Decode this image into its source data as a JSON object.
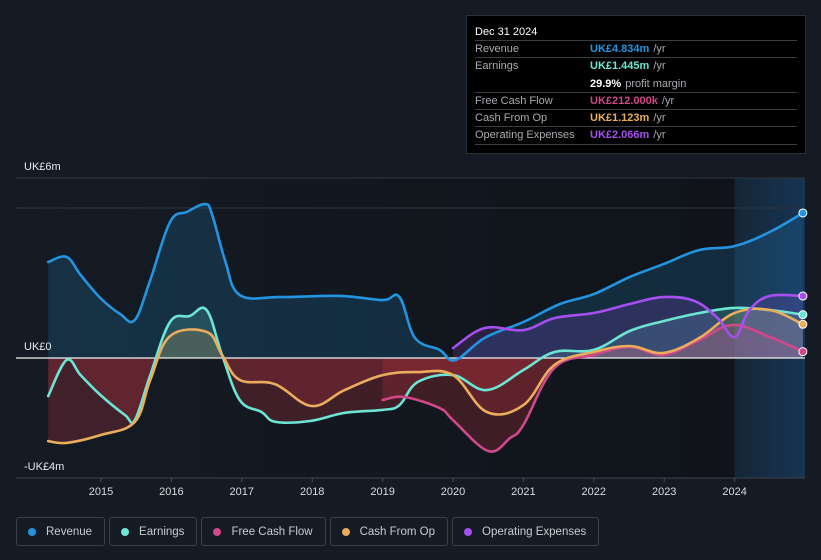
{
  "tooltip": {
    "date": "Dec 31 2024",
    "rows": [
      {
        "label": "Revenue",
        "value": "UK£4.834m",
        "unit": "/yr",
        "color": "#2394df"
      },
      {
        "label": "Earnings",
        "value": "UK£1.445m",
        "unit": "/yr",
        "color": "#6ce5d4"
      },
      {
        "label": "",
        "value": "29.9%",
        "unit": "profit margin",
        "color": "#ffffff"
      },
      {
        "label": "Free Cash Flow",
        "value": "UK£212.000k",
        "unit": "/yr",
        "color": "#d0478a"
      },
      {
        "label": "Cash From Op",
        "value": "UK£1.123m",
        "unit": "/yr",
        "color": "#e9ad5c"
      },
      {
        "label": "Operating Expenses",
        "value": "UK£2.066m",
        "unit": "/yr",
        "color": "#a54ff0"
      }
    ]
  },
  "legend": [
    {
      "label": "Revenue",
      "color": "#2394df"
    },
    {
      "label": "Earnings",
      "color": "#6ce5d4"
    },
    {
      "label": "Free Cash Flow",
      "color": "#d0478a"
    },
    {
      "label": "Cash From Op",
      "color": "#e9ad5c"
    },
    {
      "label": "Operating Expenses",
      "color": "#a54ff0"
    }
  ],
  "chart_data": {
    "type": "area",
    "title": "",
    "xlabel": "",
    "ylabel": "",
    "currency_unit": "UK£m",
    "y_tick_labels": [
      {
        "value": 6,
        "label": "UK£6m"
      },
      {
        "value": 0,
        "label": "UK£0"
      },
      {
        "value": -4,
        "label": "-UK£4m"
      }
    ],
    "ylim": [
      -4,
      6
    ],
    "xlim": [
      2014.25,
      2024.98
    ],
    "x_ticks": [
      "2015",
      "2016",
      "2017",
      "2018",
      "2019",
      "2020",
      "2021",
      "2022",
      "2023",
      "2024"
    ],
    "highlight_from": 2024.0,
    "grid": true,
    "legend_position": "bottom",
    "series": [
      {
        "name": "Revenue",
        "color": "#2394df",
        "points": [
          [
            2014.25,
            3.2
          ],
          [
            2014.51,
            3.37
          ],
          [
            2014.71,
            2.77
          ],
          [
            2014.99,
            2.0
          ],
          [
            2015.27,
            1.47
          ],
          [
            2015.48,
            1.27
          ],
          [
            2015.7,
            2.6
          ],
          [
            2015.98,
            4.53
          ],
          [
            2016.22,
            4.87
          ],
          [
            2016.48,
            5.13
          ],
          [
            2016.58,
            4.77
          ],
          [
            2016.76,
            3.27
          ],
          [
            2016.97,
            2.1
          ],
          [
            2017.54,
            2.03
          ],
          [
            2018.39,
            2.07
          ],
          [
            2019.0,
            1.93
          ],
          [
            2019.24,
            2.03
          ],
          [
            2019.46,
            0.67
          ],
          [
            2019.81,
            0.27
          ],
          [
            2020.03,
            -0.07
          ],
          [
            2020.45,
            0.67
          ],
          [
            2021.0,
            1.2
          ],
          [
            2021.52,
            1.8
          ],
          [
            2022.0,
            2.13
          ],
          [
            2022.51,
            2.7
          ],
          [
            2022.99,
            3.13
          ],
          [
            2023.5,
            3.6
          ],
          [
            2024.0,
            3.73
          ],
          [
            2024.5,
            4.2
          ],
          [
            2024.97,
            4.834
          ]
        ]
      },
      {
        "name": "Earnings",
        "color": "#6ce5d4",
        "points": [
          [
            2014.25,
            -1.27
          ],
          [
            2014.51,
            -0.07
          ],
          [
            2014.71,
            -0.57
          ],
          [
            2014.99,
            -1.23
          ],
          [
            2015.34,
            -1.9
          ],
          [
            2015.48,
            -2.07
          ],
          [
            2015.7,
            -0.57
          ],
          [
            2015.98,
            1.2
          ],
          [
            2016.26,
            1.4
          ],
          [
            2016.5,
            1.6
          ],
          [
            2016.72,
            0.1
          ],
          [
            2016.97,
            -1.4
          ],
          [
            2017.28,
            -1.8
          ],
          [
            2017.48,
            -2.13
          ],
          [
            2017.97,
            -2.1
          ],
          [
            2018.46,
            -1.83
          ],
          [
            2019.0,
            -1.73
          ],
          [
            2019.24,
            -1.57
          ],
          [
            2019.5,
            -0.8
          ],
          [
            2020.0,
            -0.57
          ],
          [
            2020.48,
            -1.07
          ],
          [
            2021.0,
            -0.4
          ],
          [
            2021.44,
            0.2
          ],
          [
            2022.0,
            0.27
          ],
          [
            2022.51,
            0.9
          ],
          [
            2022.99,
            1.23
          ],
          [
            2023.5,
            1.5
          ],
          [
            2024.0,
            1.67
          ],
          [
            2024.5,
            1.6
          ],
          [
            2024.97,
            1.445
          ]
        ]
      },
      {
        "name": "Free Cash Flow",
        "color": "#d0478a",
        "points": [
          [
            2019.0,
            -1.4
          ],
          [
            2019.31,
            -1.3
          ],
          [
            2019.81,
            -1.67
          ],
          [
            2020.0,
            -2.07
          ],
          [
            2020.5,
            -3.1
          ],
          [
            2020.81,
            -2.67
          ],
          [
            2021.0,
            -2.23
          ],
          [
            2021.44,
            -0.33
          ],
          [
            2022.0,
            0.1
          ],
          [
            2022.51,
            0.37
          ],
          [
            2022.99,
            0.1
          ],
          [
            2023.5,
            0.6
          ],
          [
            2023.97,
            1.1
          ],
          [
            2024.5,
            0.7
          ],
          [
            2024.97,
            0.212
          ]
        ]
      },
      {
        "name": "Cash From Op",
        "color": "#e9ad5c",
        "points": [
          [
            2014.25,
            -2.77
          ],
          [
            2014.51,
            -2.83
          ],
          [
            2014.99,
            -2.57
          ],
          [
            2015.48,
            -2.13
          ],
          [
            2015.7,
            -0.73
          ],
          [
            2015.98,
            0.73
          ],
          [
            2016.5,
            0.87
          ],
          [
            2016.72,
            0.1
          ],
          [
            2016.97,
            -0.73
          ],
          [
            2017.47,
            -0.87
          ],
          [
            2017.99,
            -1.6
          ],
          [
            2018.46,
            -1.07
          ],
          [
            2019.0,
            -0.57
          ],
          [
            2019.5,
            -0.47
          ],
          [
            2020.0,
            -0.57
          ],
          [
            2020.48,
            -1.8
          ],
          [
            2021.0,
            -1.57
          ],
          [
            2021.44,
            -0.23
          ],
          [
            2022.0,
            0.2
          ],
          [
            2022.51,
            0.4
          ],
          [
            2022.99,
            0.17
          ],
          [
            2023.5,
            0.67
          ],
          [
            2024.0,
            1.5
          ],
          [
            2024.5,
            1.6
          ],
          [
            2024.97,
            1.123
          ]
        ]
      },
      {
        "name": "Operating Expenses",
        "color": "#a54ff0",
        "points": [
          [
            2020.0,
            0.33
          ],
          [
            2020.45,
            1.0
          ],
          [
            2021.0,
            0.93
          ],
          [
            2021.44,
            1.33
          ],
          [
            2022.0,
            1.5
          ],
          [
            2022.51,
            1.8
          ],
          [
            2022.99,
            2.03
          ],
          [
            2023.43,
            1.9
          ],
          [
            2023.76,
            1.33
          ],
          [
            2024.0,
            0.7
          ],
          [
            2024.21,
            1.6
          ],
          [
            2024.5,
            2.07
          ],
          [
            2024.97,
            2.066
          ]
        ]
      }
    ]
  }
}
